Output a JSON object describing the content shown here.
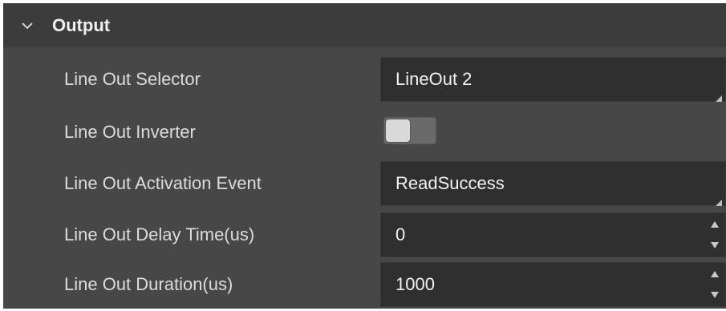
{
  "section": {
    "title": "Output",
    "icon": "chevron-down-icon"
  },
  "fields": {
    "line_out_selector": {
      "label": "Line Out Selector",
      "value": "LineOut 2",
      "type": "dropdown"
    },
    "line_out_inverter": {
      "label": "Line Out Inverter",
      "enabled": false,
      "type": "toggle"
    },
    "line_out_activation_event": {
      "label": "Line Out Activation Event",
      "value": "ReadSuccess",
      "type": "dropdown"
    },
    "line_out_delay_time": {
      "label": "Line Out Delay Time(us)",
      "value": "0",
      "type": "spinbox"
    },
    "line_out_duration": {
      "label": "Line Out Duration(us)",
      "value": "1000",
      "type": "spinbox"
    }
  },
  "colors": {
    "panel_bg": "#474747",
    "header_bg": "#3c3c3c",
    "control_bg": "#2f2f2f",
    "text": "#dcdcdc"
  }
}
